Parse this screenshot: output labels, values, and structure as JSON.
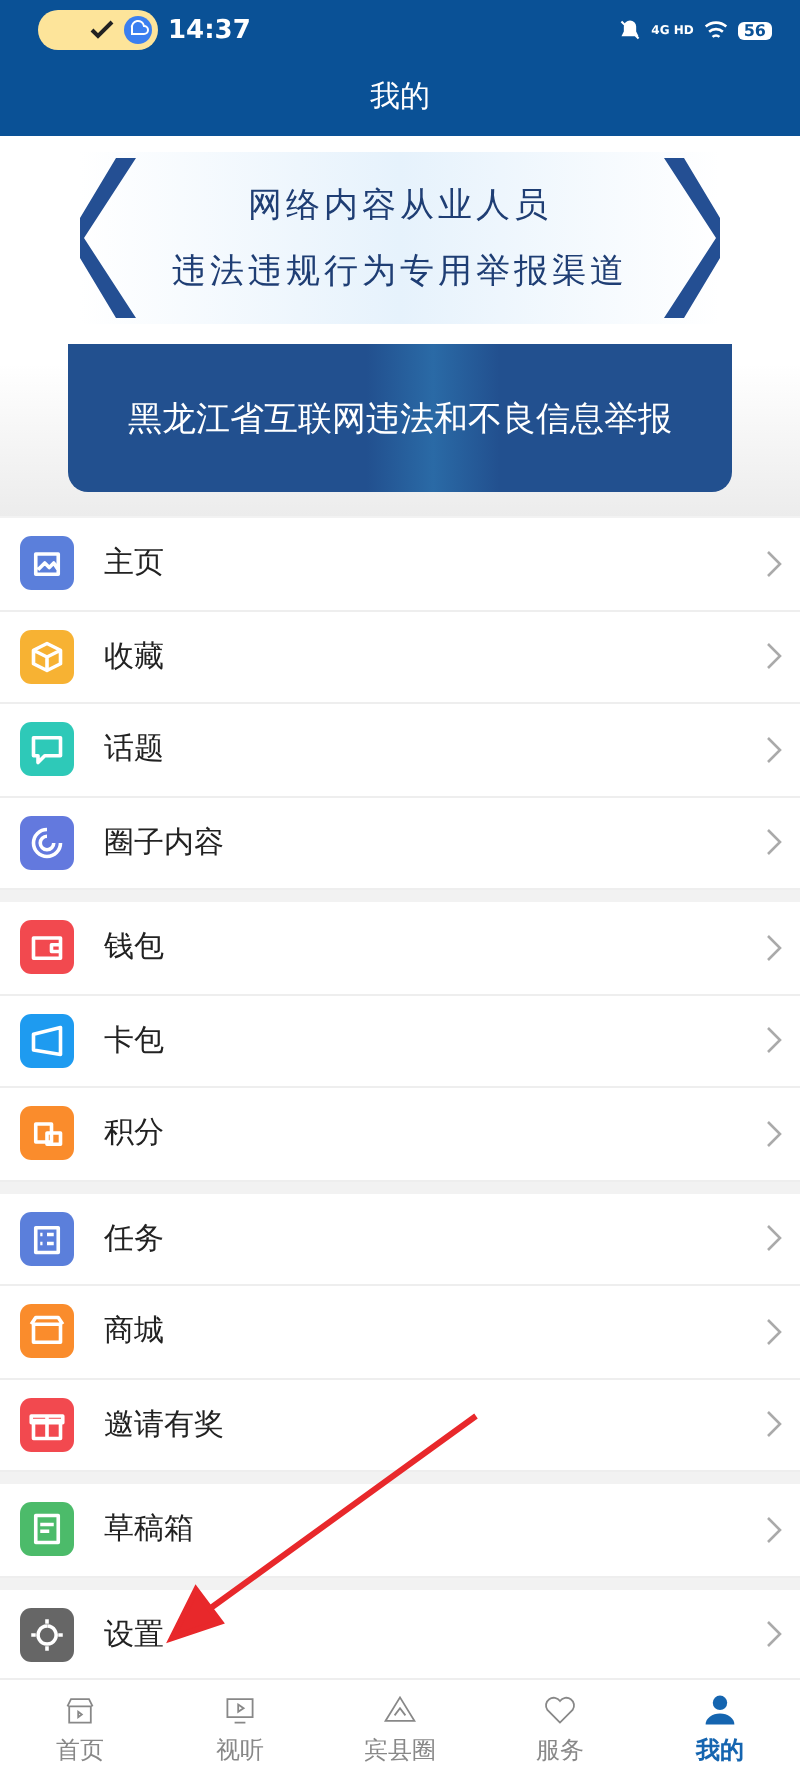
{
  "status_bar": {
    "time": "14:37",
    "network": "4G HD",
    "battery": "56"
  },
  "header": {
    "title": "我的"
  },
  "banner": {
    "line_1": "网络内容从业人员",
    "line_2": "违法违规行为专用举报渠道",
    "button": "黑龙江省互联网违法和不良信息举报"
  },
  "menu_groups": [
    {
      "items": [
        {
          "label": "主页",
          "color": "#5b7fdb"
        },
        {
          "label": "收藏",
          "color": "#f7b233"
        },
        {
          "label": "话题",
          "color": "#2ec9b8"
        },
        {
          "label": "圈子内容",
          "color": "#6379de"
        }
      ]
    },
    {
      "items": [
        {
          "label": "钱包",
          "color": "#f2494f"
        },
        {
          "label": "卡包",
          "color": "#1e9bf0"
        },
        {
          "label": "积分",
          "color": "#fa8c2c"
        }
      ]
    },
    {
      "items": [
        {
          "label": "任务",
          "color": "#5b7fdb"
        },
        {
          "label": "商城",
          "color": "#fa8c2c"
        },
        {
          "label": "邀请有奖",
          "color": "#f2494f"
        }
      ]
    },
    {
      "items": [
        {
          "label": "草稿箱",
          "color": "#4cbb6a"
        }
      ]
    },
    {
      "items": [
        {
          "label": "设置",
          "color": "#666666"
        }
      ]
    }
  ],
  "bottom_nav": [
    {
      "label": "首页",
      "selected": false
    },
    {
      "label": "视听",
      "selected": false
    },
    {
      "label": "宾县圈",
      "selected": false
    },
    {
      "label": "服务",
      "selected": false
    },
    {
      "label": "我的",
      "selected": true
    }
  ]
}
